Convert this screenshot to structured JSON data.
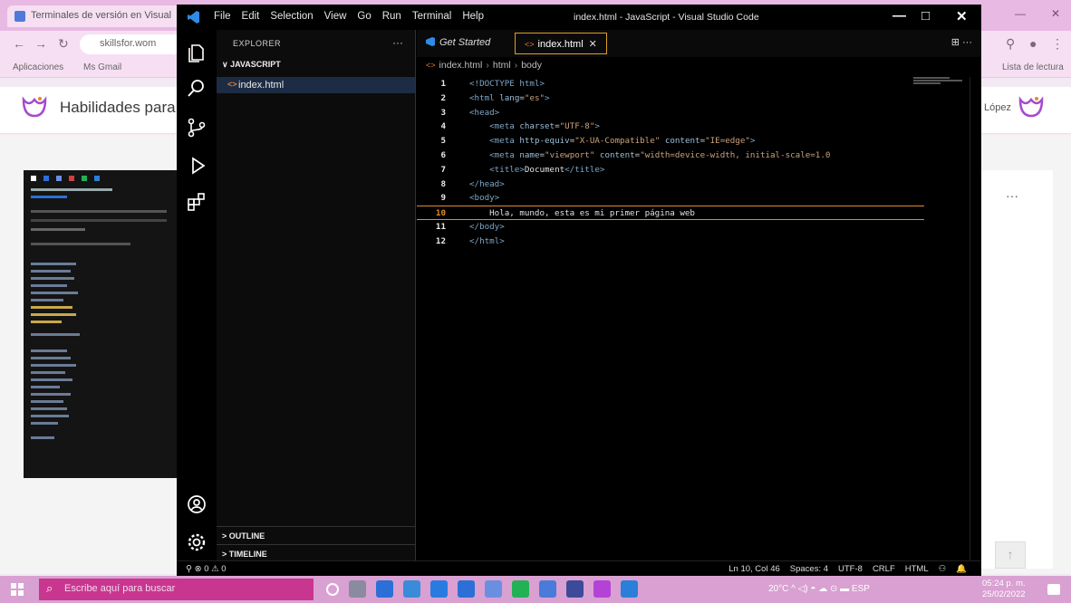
{
  "browser": {
    "tab_title": "Terminales de versión en Visual",
    "url": "skillsfor.wom",
    "bookmarks": [
      "Aplicaciones",
      "Ms Gmail",
      "Lista de lectura"
    ],
    "site_title": "Habilidades para",
    "user_name": "López",
    "more": "···",
    "scroll_top": "↑"
  },
  "vscode": {
    "menu": [
      "File",
      "Edit",
      "Selection",
      "View",
      "Go",
      "Run",
      "Terminal",
      "Help"
    ],
    "window_title": "index.html - JavaScript - Visual Studio Code",
    "explorer": {
      "header": "EXPLORER",
      "more": "···",
      "folder": "∨ JAVASCRIPT",
      "file": "index.html",
      "outline": "> OUTLINE",
      "timeline": "> TIMELINE"
    },
    "tabs": [
      {
        "label": "Get Started"
      },
      {
        "label": "index.html",
        "close": "✕"
      }
    ],
    "editor_actions": "⊞ ···",
    "breadcrumb": [
      "index.html",
      "html",
      "body"
    ],
    "code_lines": [
      {
        "n": "1",
        "html": "<span class='tag'>&lt;!DOCTYPE html&gt;</span>"
      },
      {
        "n": "2",
        "html": "<span class='tag'>&lt;html</span> <span class='attr'>lang</span>=<span class='str'>\"es\"</span><span class='tag'>&gt;</span>"
      },
      {
        "n": "3",
        "html": "<span class='tag'>&lt;head&gt;</span>"
      },
      {
        "n": "4",
        "html": "    <span class='tag'>&lt;meta</span> <span class='attr'>charset</span>=<span class='str'>\"UTF-8\"</span><span class='tag'>&gt;</span>"
      },
      {
        "n": "5",
        "html": "    <span class='tag'>&lt;meta</span> <span class='attr'>http-equiv</span>=<span class='str'>\"X-UA-Compatible\"</span> <span class='attr'>content</span>=<span class='str'>\"IE=edge\"</span><span class='tag'>&gt;</span>"
      },
      {
        "n": "6",
        "html": "    <span class='tag'>&lt;meta</span> <span class='attr'>name</span>=<span class='str'>\"viewport\"</span> <span class='attr'>content</span>=<span class='str'>\"width=device-width, initial-scale=1.0</span>"
      },
      {
        "n": "7",
        "html": "    <span class='tag'>&lt;title&gt;</span><span class='txt'>Document</span><span class='tag'>&lt;/title&gt;</span>"
      },
      {
        "n": "8",
        "html": "<span class='tag'>&lt;/head&gt;</span>"
      },
      {
        "n": "9",
        "html": "<span class='tag'>&lt;body&gt;</span>"
      },
      {
        "n": "10",
        "html": "    <span class='txt'>Hola, mundo, esta es mi primer página web</span>"
      },
      {
        "n": "11",
        "html": "<span class='tag'>&lt;/body&gt;</span>"
      },
      {
        "n": "12",
        "html": "<span class='tag'>&lt;/html&gt;</span>"
      }
    ],
    "active_line": "10",
    "status_left": "⚲  ⊗ 0 ⚠ 0",
    "status_right": [
      "Ln 10, Col 46",
      "Spaces: 4",
      "UTF-8",
      "CRLF",
      "HTML",
      "⚇",
      "🔔"
    ]
  },
  "taskbar": {
    "search_placeholder": "Escribe aquí para buscar",
    "tray": "20°C  ^  ◁)  ◓  ☁  ⊙  ▬  ESP",
    "time": "05:24 p. m.",
    "date": "25/02/2022",
    "app_colors": [
      "#ffffff",
      "#8a8aa0",
      "#2c6fd6",
      "#3a8bd8",
      "#2a7be0",
      "#2c6fd6",
      "#6a8fe0",
      "#22b155",
      "#4a7bd8",
      "#3d4a9a",
      "#b542d6",
      "#2b7fd8"
    ]
  }
}
